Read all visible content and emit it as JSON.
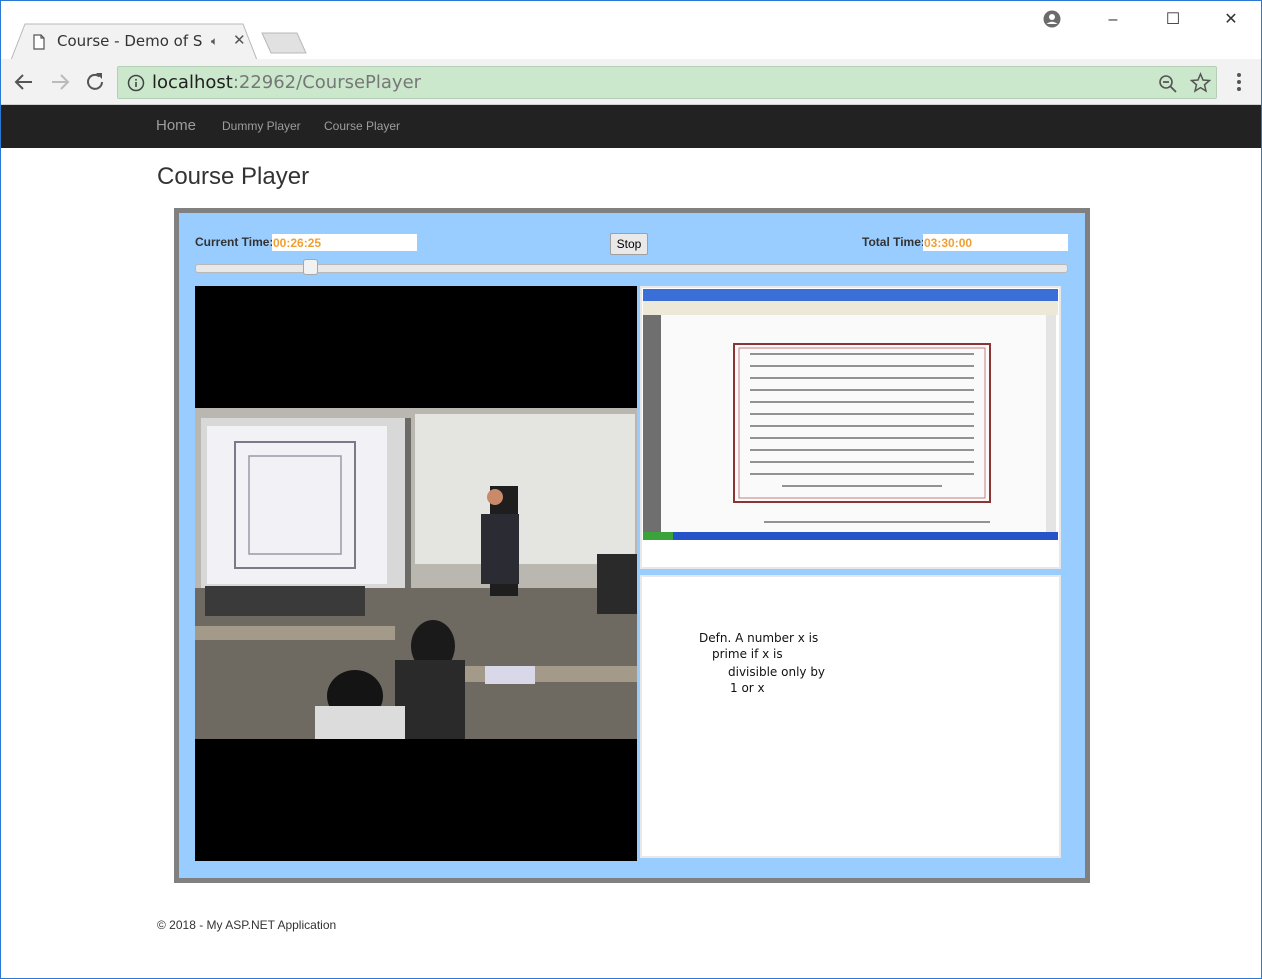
{
  "browser": {
    "tab_title": "Course - Demo of Sign",
    "url_host": "localhost",
    "url_rest": ":22962/CoursePlayer"
  },
  "site": {
    "brand": "Home",
    "nav": [
      {
        "label": "Dummy Player"
      },
      {
        "label": "Course Player"
      }
    ]
  },
  "page": {
    "title": "Course Player"
  },
  "player": {
    "current_time_label": "Current Time:",
    "current_time": "00:26:25",
    "stop_label": "Stop",
    "total_time_label": "Total Time:",
    "total_time": "03:30:00",
    "progress_fraction": 0.126
  },
  "whiteboard": {
    "lines": [
      "Defn.  A number x is",
      "prime if x is",
      "divisible only by",
      "1 or x"
    ]
  },
  "footer": {
    "text": "© 2018 - My ASP.NET Application"
  },
  "colors": {
    "player_bg": "#99ccff",
    "player_border": "#808080",
    "time_text": "#f0a030",
    "navbar": "#222222",
    "omnibox": "#cbe8cd"
  }
}
